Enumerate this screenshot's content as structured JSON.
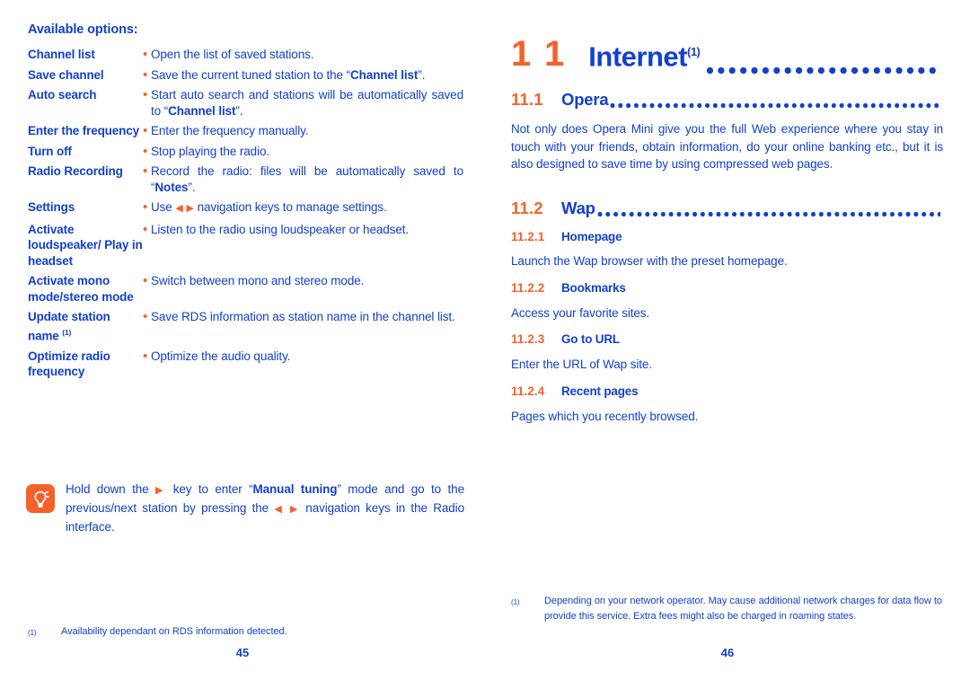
{
  "left_page": {
    "available_options_title": "Available options:",
    "options": [
      {
        "label": "Channel list",
        "desc_html": "Open the list of saved stations.",
        "justify": false
      },
      {
        "label": "Save channel",
        "desc_html": "Save the current tuned station to the “<b>Channel list</b>”.",
        "justify": true
      },
      {
        "label": "Auto search",
        "desc_html": "Start auto search and stations will be automatically saved to “<b>Channel list</b>”.",
        "justify": true
      },
      {
        "label": "Enter the frequency",
        "desc_html": "Enter the frequency manually.",
        "justify": false
      },
      {
        "label": "Turn off",
        "desc_html": "Stop playing the radio.",
        "justify": false
      },
      {
        "label": "Radio Recording",
        "desc_html": "Record the radio: files will be automatically saved to “<b>Notes</b>”.",
        "justify": true
      },
      {
        "label": "Settings",
        "desc_html": "Use <span class=\"arrow-l\">◀</span> <span class=\"arrow-r\">▶</span> navigation keys to manage settings.",
        "justify": false
      },
      {
        "label": "Activate loudspeaker/ Play in headset",
        "desc_html": "Listen to the radio using loudspeaker or headset.",
        "justify": false
      },
      {
        "label": "Activate mono mode/stereo mode",
        "desc_html": "Switch between mono and stereo mode.",
        "justify": false
      },
      {
        "label": "Update station name <span class=\"sup\">(1)</span>",
        "desc_html": "Save RDS information as station name in the channel list.",
        "justify": true
      },
      {
        "label": "Optimize radio frequency",
        "desc_html": "Optimize the audio quality.",
        "justify": false
      }
    ],
    "tip": {
      "icon": "lightbulb-icon",
      "text_html": "Hold down the <span class=\"arrow-r\">▶</span> key to enter “<b>Manual tuning</b>” mode and go to the previous/next station by pressing the <span class=\"arrow-l\">◀</span> <span class=\"arrow-r\">▶</span> navigation keys in the Radio interface."
    },
    "footnote_mark": "(1)",
    "footnote_text": "Availability dependant on RDS information detected.",
    "page_number": "45"
  },
  "right_page": {
    "chapter_number": "11",
    "chapter_title": "Internet",
    "chapter_footnote_mark": "(1)",
    "sections": [
      {
        "num": "11.1",
        "title": "Opera"
      },
      {
        "num": "11.2",
        "title": "Wap"
      }
    ],
    "opera_paragraph": "Not only does Opera Mini give you the full Web experience where you stay in touch with your friends, obtain information, do your online banking etc., but it is also designed to save time by using compressed web pages.",
    "wap_subsections": [
      {
        "num": "11.2.1",
        "title": "Homepage",
        "desc": "Launch the Wap browser with the preset homepage."
      },
      {
        "num": "11.2.2",
        "title": "Bookmarks",
        "desc": "Access your favorite sites."
      },
      {
        "num": "11.2.3",
        "title": "Go to URL",
        "desc": "Enter the URL of Wap site."
      },
      {
        "num": "11.2.4",
        "title": "Recent pages",
        "desc": "Pages which you recently browsed."
      }
    ],
    "footnote_mark": "(1)",
    "footnote_text": "Depending on your network operator. May cause additional network charges for data flow to provide this service. Extra fees might also be charged in roaming states.",
    "page_number": "46"
  },
  "colors": {
    "text_blue": "#1340cc",
    "accent_orange": "#f4622a",
    "background": "#ffffff"
  }
}
